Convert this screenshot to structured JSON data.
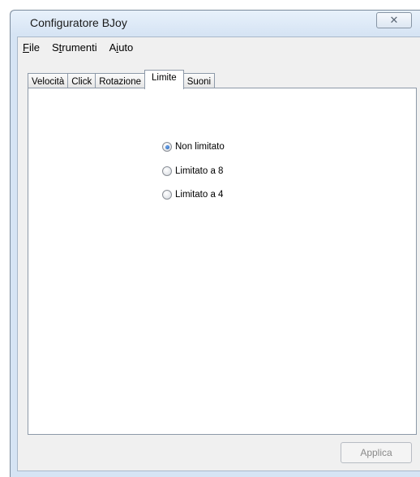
{
  "window": {
    "title": "Configuratore BJoy",
    "close_glyph": "✕"
  },
  "menu": {
    "items": [
      {
        "label": "File",
        "accel": "F"
      },
      {
        "label": "Strumenti",
        "accel": "t"
      },
      {
        "label": "Aiuto",
        "accel": "i"
      }
    ]
  },
  "tabs": [
    {
      "label": "Velocità",
      "active": false
    },
    {
      "label": "Click",
      "active": false
    },
    {
      "label": "Rotazione",
      "active": false
    },
    {
      "label": "Limite",
      "active": true
    },
    {
      "label": "Suoni",
      "active": false
    }
  ],
  "limit_options": [
    {
      "label": "Non limitato",
      "checked": true
    },
    {
      "label": "Limitato a 8",
      "checked": false
    },
    {
      "label": "Limitato a 4",
      "checked": false
    }
  ],
  "apply_button": {
    "label": "Applica",
    "enabled": false
  }
}
